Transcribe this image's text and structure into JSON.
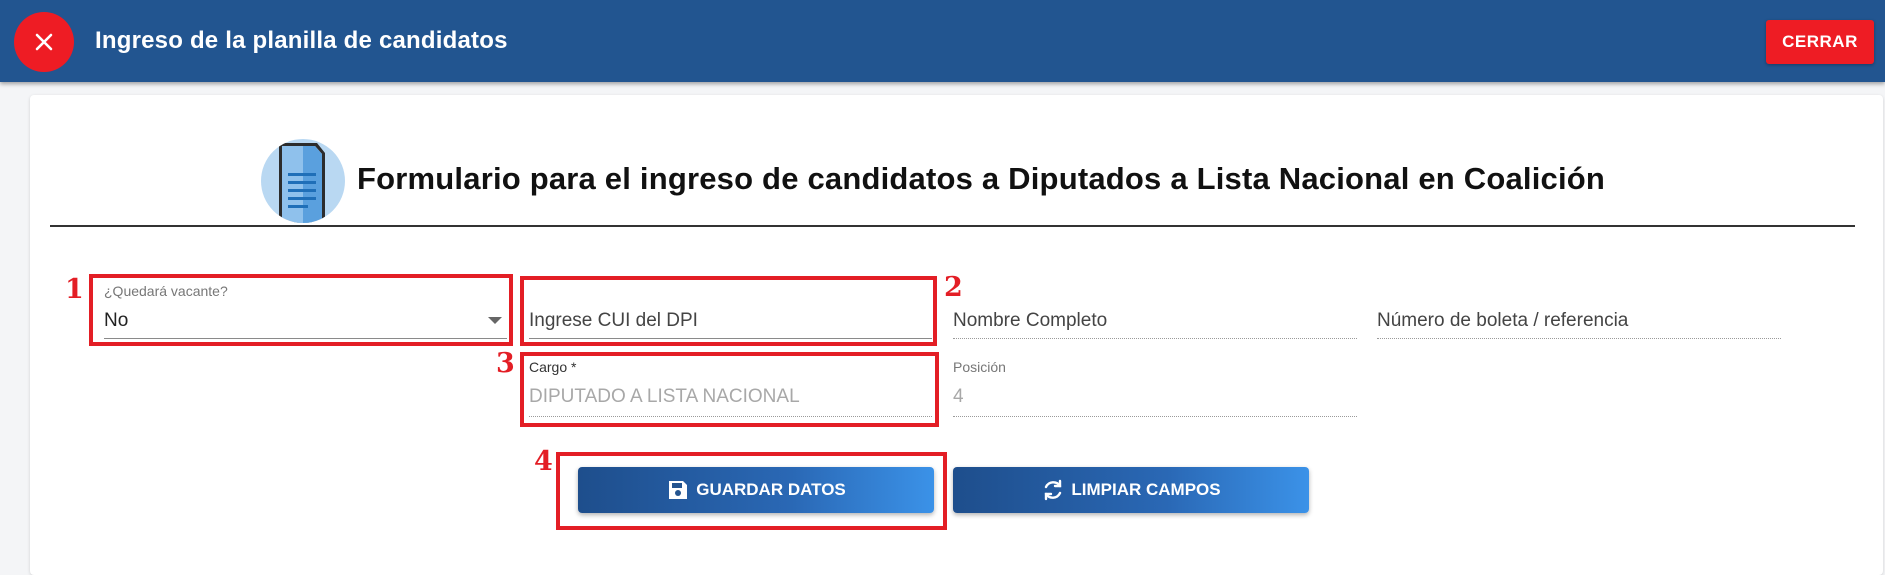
{
  "topbar": {
    "title": "Ingreso de la planilla de candidatos",
    "close_label": "CERRAR",
    "accent_color": "#225590",
    "close_color": "#ee1c24"
  },
  "form": {
    "icon": "document-icon",
    "title": "Formulario para el ingreso de candidatos a Diputados a Lista Nacional en Coalición",
    "fields": {
      "vacante": {
        "label": "¿Quedará vacante?",
        "value": "No"
      },
      "cui": {
        "placeholder": "Ingrese CUI del DPI"
      },
      "nombre": {
        "placeholder": "Nombre Completo"
      },
      "boleta": {
        "placeholder": "Número de boleta / referencia"
      },
      "cargo": {
        "label": "Cargo *",
        "value": "DIPUTADO A LISTA NACIONAL"
      },
      "posicion": {
        "label": "Posición",
        "value": "4"
      }
    },
    "buttons": {
      "save_label": "GUARDAR DATOS",
      "save_icon": "floppy-disk-icon",
      "clear_label": "LIMPIAR CAMPOS",
      "clear_icon": "refresh-icon"
    }
  },
  "annotations": {
    "color": "#e31e25",
    "labels": [
      "1",
      "2",
      "3",
      "4"
    ]
  }
}
